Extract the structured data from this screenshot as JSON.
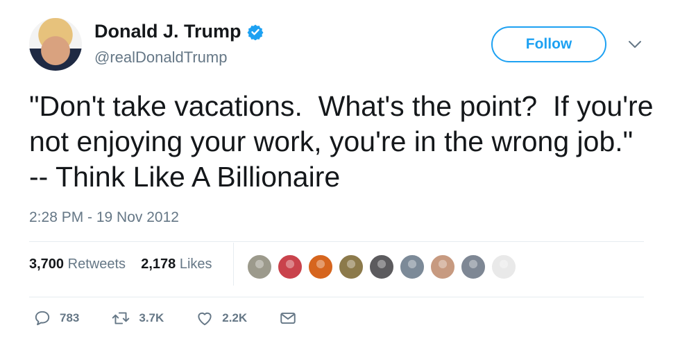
{
  "author": {
    "name": "Donald J. Trump",
    "handle": "@realDonaldTrump",
    "verified": true,
    "avatar_icon": "profile-photo"
  },
  "follow_button": {
    "label": "Follow"
  },
  "caret_icon": "chevron-down-icon",
  "tweet": {
    "text": "\"Don't take vacations.  What's the point?  If you're not enjoying your work, you're in the wrong job.\"  -- Think Like A Billionaire",
    "timestamp": "2:28 PM - 19 Nov 2012"
  },
  "stats": {
    "retweets_count": "3,700",
    "retweets_label": "Retweets",
    "likes_count": "2,178",
    "likes_label": "Likes"
  },
  "liker_avatars": [
    {
      "color": "#9c9a8c"
    },
    {
      "color": "#c9434c"
    },
    {
      "color": "#d6651e"
    },
    {
      "color": "#8c7a4b"
    },
    {
      "color": "#5c5b5e"
    },
    {
      "color": "#7c8a98"
    },
    {
      "color": "#c79a80"
    },
    {
      "color": "#7e8794"
    },
    {
      "color": "#e9e9e9"
    }
  ],
  "actions": {
    "replies": "783",
    "retweets": "3.7K",
    "likes": "2.2K"
  },
  "colors": {
    "accent": "#1da1f2",
    "text": "#14171a",
    "muted": "#657786",
    "divider": "#e6ecf0"
  }
}
